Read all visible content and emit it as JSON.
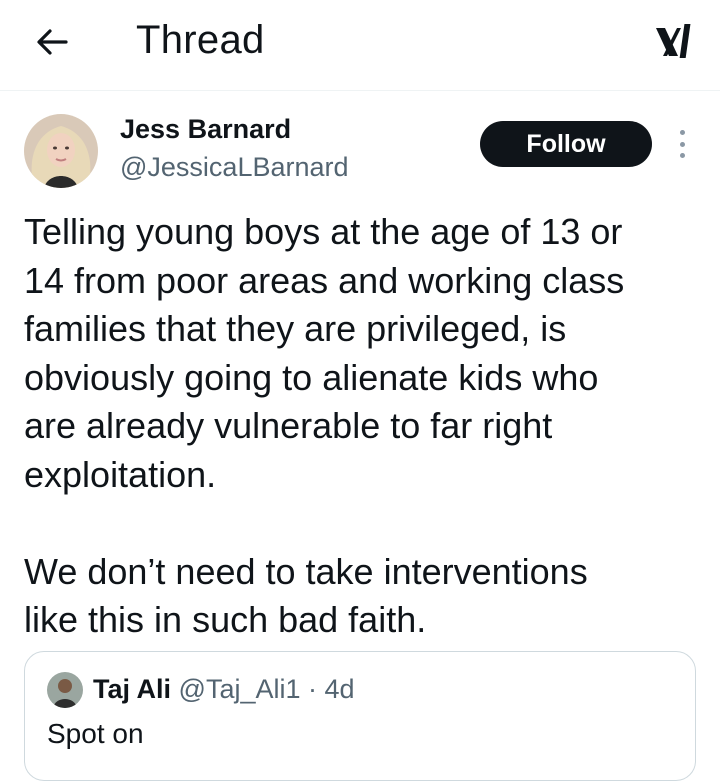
{
  "header": {
    "title": "Thread",
    "back_icon": "arrow-left-icon",
    "brand_icon": "x-logo-icon"
  },
  "post": {
    "author_name": "Jess Barnard",
    "author_handle": "@JessicaLBarnard",
    "follow_label": "Follow",
    "text": "Telling young boys at the age of 13 or\n14 from poor areas and working class\nfamilies that they are privileged, is\nobviously going to alienate kids who\nare already vulnerable to far right\nexploitation.\n\nWe don’t need to take interventions\nlike this in such bad faith."
  },
  "quoted": {
    "author_name": "Taj Ali",
    "author_handle": "@Taj_Ali1",
    "separator": "·",
    "time": "4d",
    "text": "Spot on"
  },
  "colors": {
    "text": "#0f1419",
    "secondary": "#536471",
    "button_bg": "#0f1419",
    "border": "#cfd9de"
  }
}
